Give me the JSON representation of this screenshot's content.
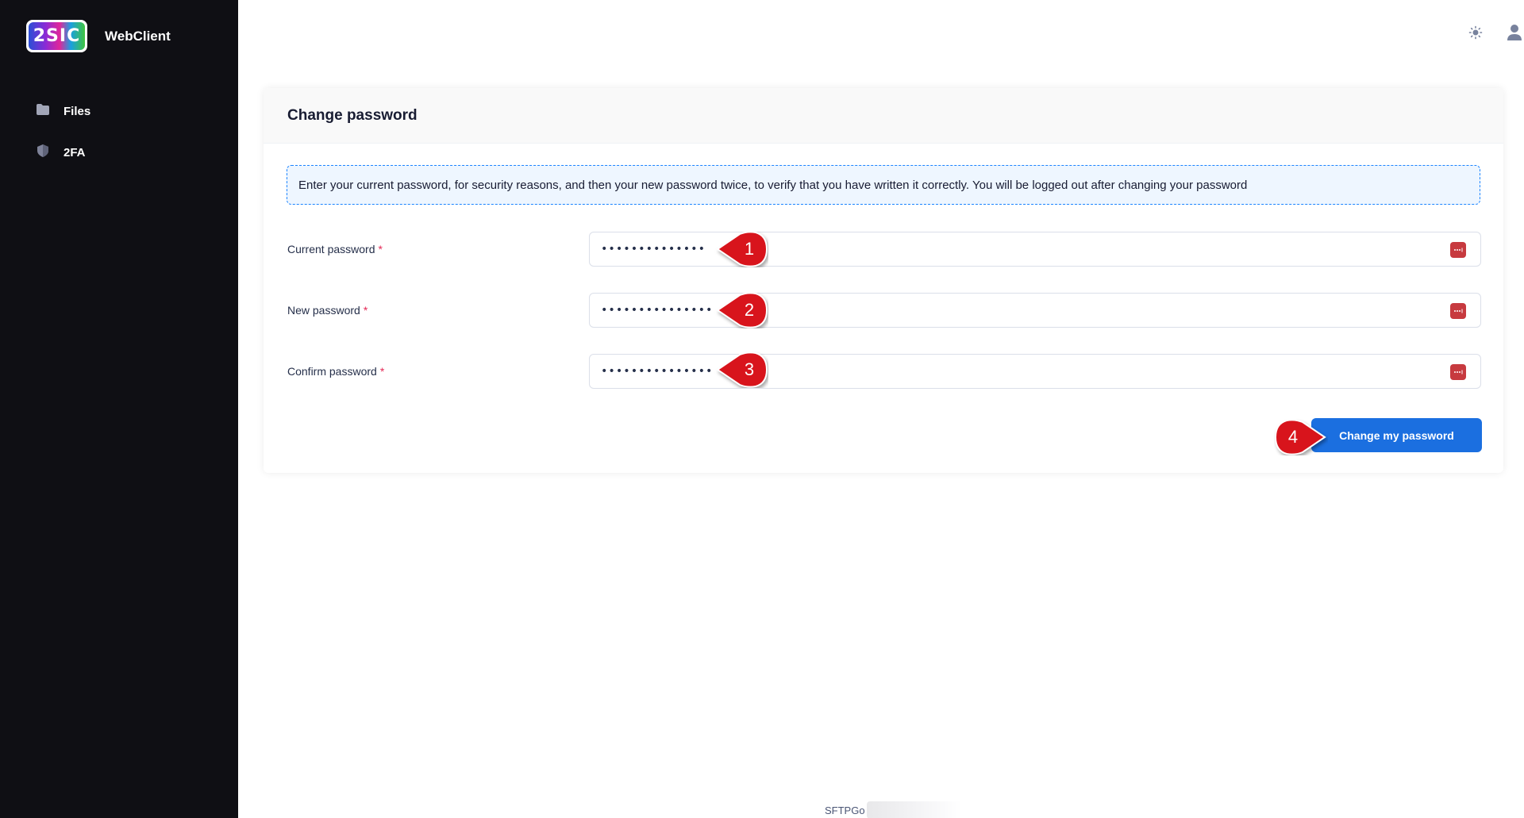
{
  "app": {
    "brand_name": "WebClient",
    "logo_text": "2SIC"
  },
  "sidebar": {
    "items": [
      {
        "label": "Files",
        "icon": "folder-icon"
      },
      {
        "label": "2FA",
        "icon": "shield-icon"
      }
    ]
  },
  "topbar": {
    "theme_icon": "sun-icon",
    "user_icon": "user-icon"
  },
  "card": {
    "title": "Change password",
    "notice": "Enter your current password, for security reasons, and then your new password twice, to verify that you have written it correctly. You will be logged out after changing your password",
    "fields": {
      "current": {
        "label": "Current password",
        "required": "*",
        "value": "••••••••••••••"
      },
      "new": {
        "label": "New password",
        "required": "*",
        "value": "•••••••••••••••"
      },
      "confirm": {
        "label": "Confirm password",
        "required": "*",
        "value": "•••••••••••••••"
      }
    },
    "submit_label": "Change my password"
  },
  "markers": [
    "1",
    "2",
    "3",
    "4"
  ],
  "footer": {
    "text": "SFTPGo"
  },
  "colors": {
    "sidebar_bg": "#0f0f14",
    "primary": "#1b6fe0",
    "marker_red": "#d8141c",
    "required_red": "#e42855"
  }
}
